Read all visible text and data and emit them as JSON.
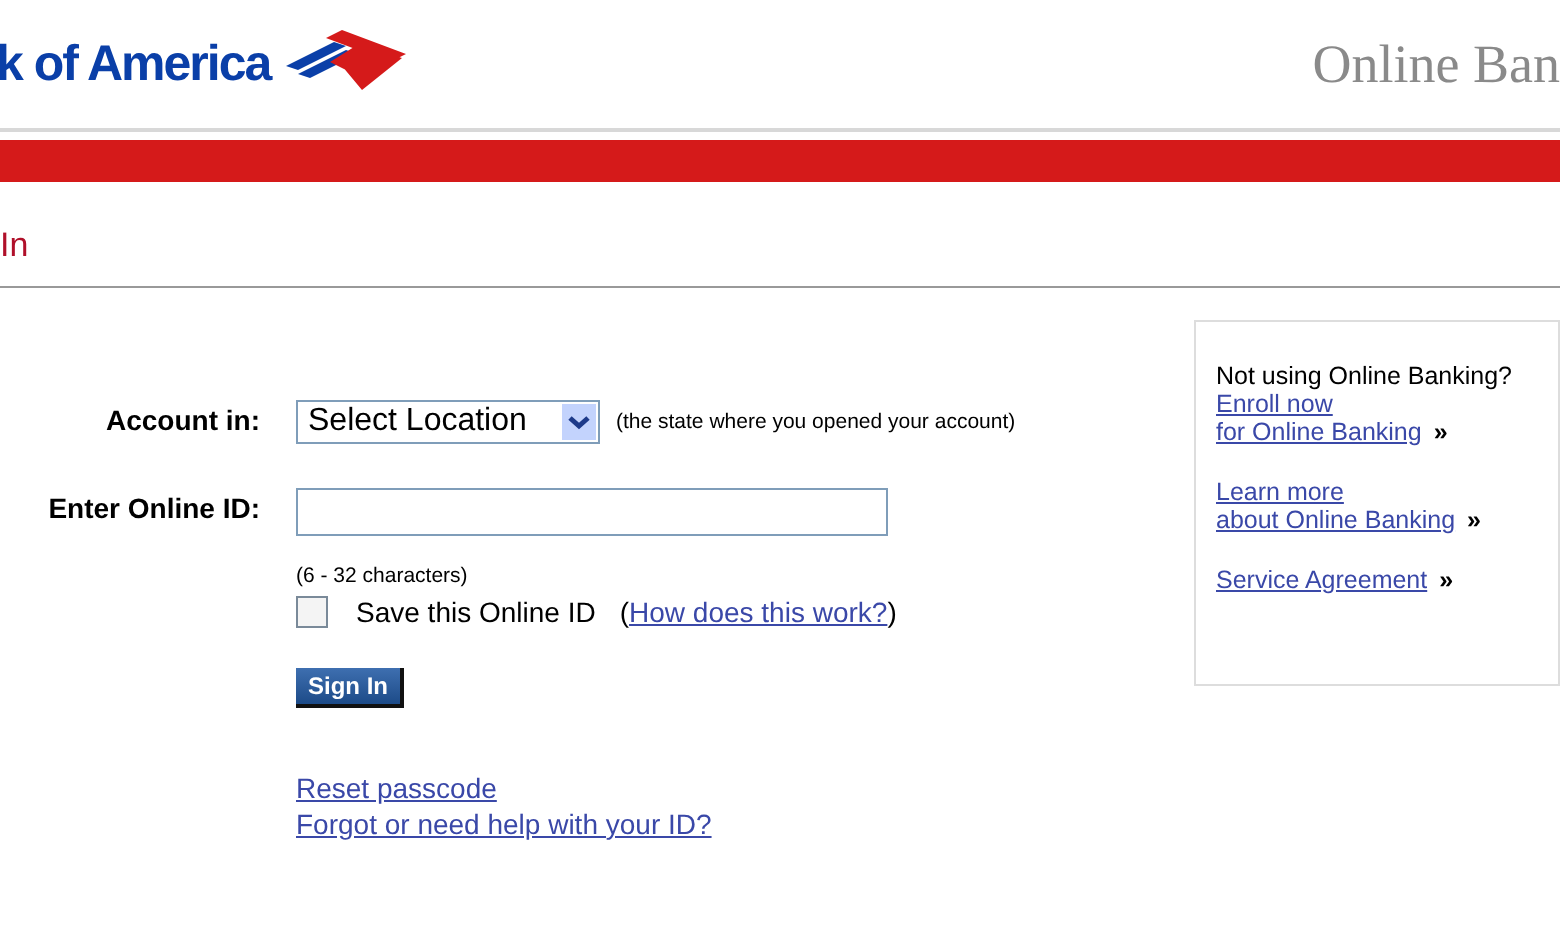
{
  "header": {
    "logo_text": "k of America",
    "title": "Online Ban"
  },
  "page_title": "In",
  "form": {
    "account_label": "Account in:",
    "location_select": "Select Location",
    "location_hint": "(the state where you opened your account)",
    "id_label": "Enter Online ID:",
    "id_hint": "(6 - 32 characters)",
    "save_id": {
      "label": "Save this Online ID",
      "checked": false
    },
    "help_open": "(",
    "help_link": "How does this work?",
    "help_close": ")",
    "sign_in": "Sign In",
    "links": [
      "Reset passcode",
      "Forgot or need help with your ID?"
    ]
  },
  "sidebar": {
    "heading": "Not using Online Banking?",
    "links": [
      {
        "lines": [
          "Enroll now",
          "for Online Banking"
        ],
        "arrow": "»"
      },
      {
        "lines": [
          "Learn more",
          "about Online Banking"
        ],
        "arrow": "»"
      },
      {
        "lines": [
          "Service Agreement"
        ],
        "arrow": "»"
      }
    ]
  }
}
